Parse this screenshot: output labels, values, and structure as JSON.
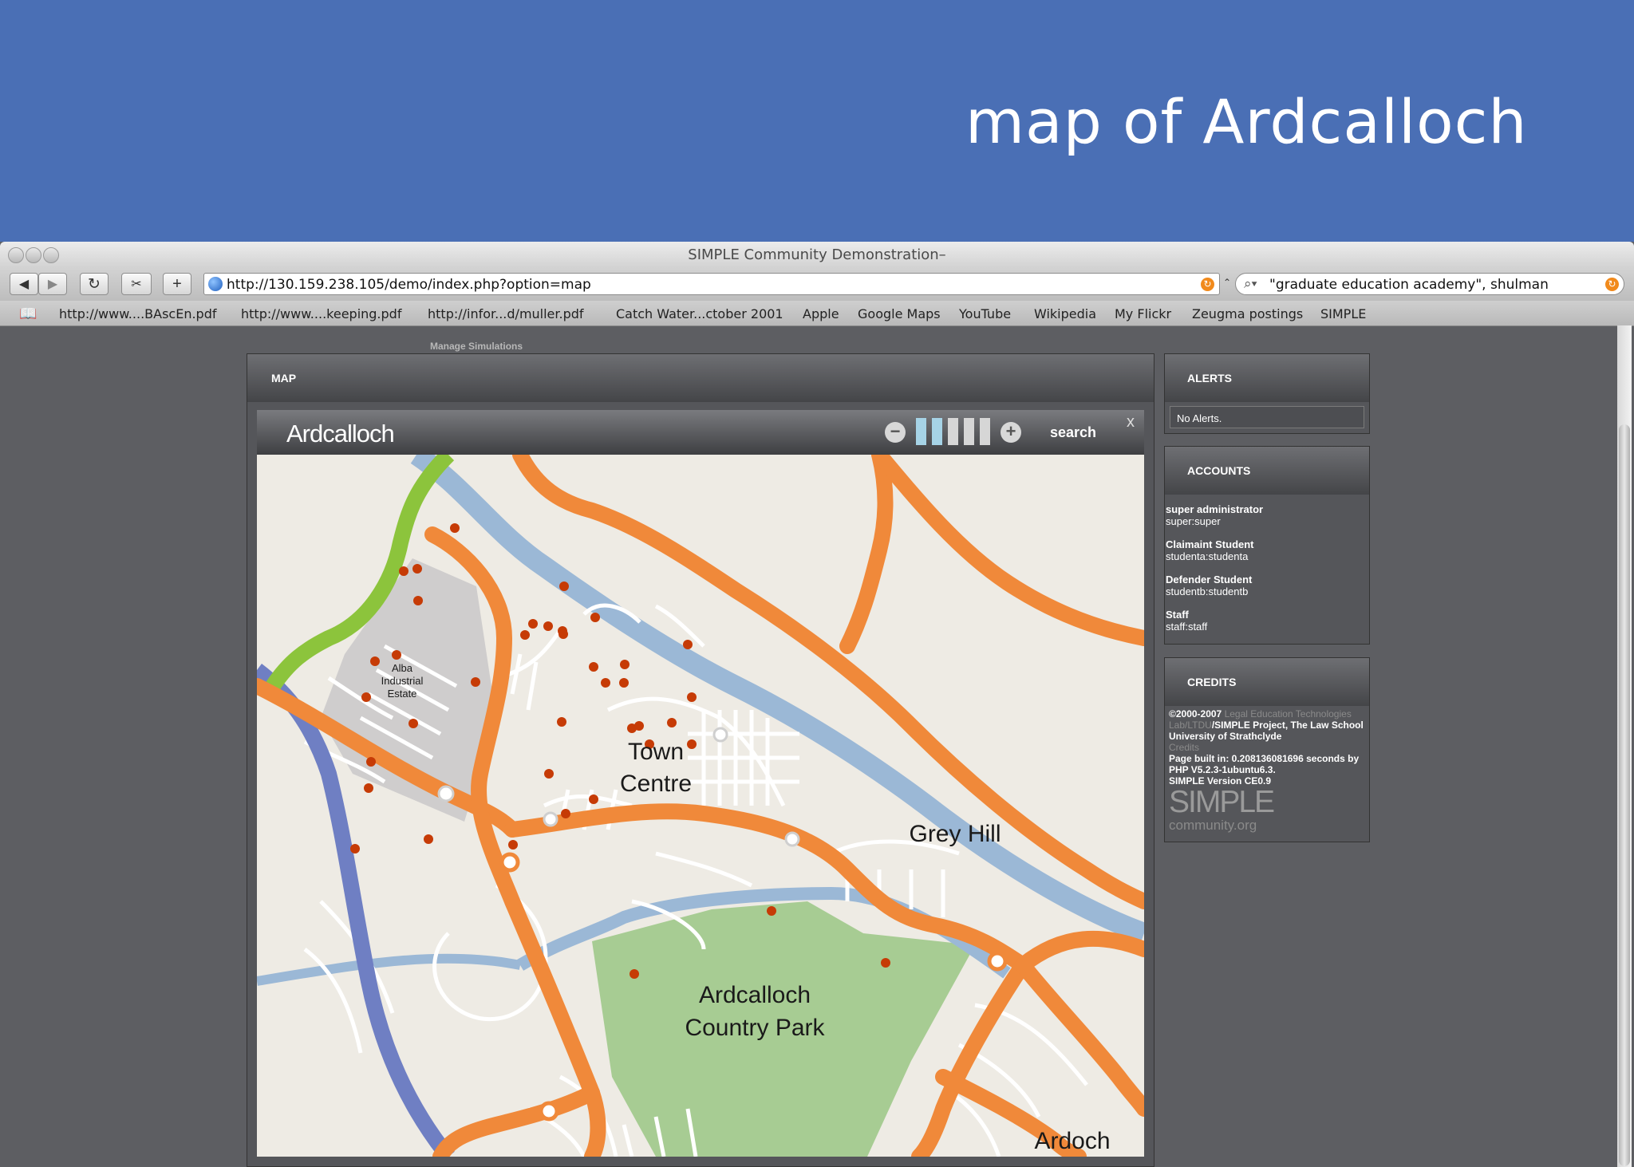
{
  "slide": {
    "title": "map of Ardcalloch"
  },
  "browser": {
    "window_title": "SIMPLE Community Demonstration–",
    "url": "http://130.159.238.105/demo/index.php?option=map",
    "search_value": "\"graduate education academy\", shulman",
    "bookmarks": [
      "http://www....BAscEn.pdf",
      "http://www....keeping.pdf",
      "http://infor...d/muller.pdf",
      "Catch Water...ctober 2001",
      "Apple",
      "Google Maps",
      "YouTube",
      "Wikipedia",
      "My Flickr",
      "Zeugma postings",
      "SIMPLE"
    ]
  },
  "page": {
    "manage_link": "Manage Simulations",
    "map_panel": {
      "header": "MAP",
      "widget_title": "Ardcalloch",
      "search_label": "search",
      "close_label": "x",
      "zoom_out": "−",
      "zoom_in": "+",
      "zoom_level": 2,
      "zoom_levels": 5,
      "place_labels": {
        "industrial": [
          "Alba",
          "Industrial",
          "Estate"
        ],
        "town_centre": [
          "Town",
          "Centre"
        ],
        "grey_hill": "Grey Hill",
        "park": [
          "Ardcalloch",
          "Country Park"
        ],
        "ardoch": "Ardoch"
      }
    },
    "alerts": {
      "header": "ALERTS",
      "message": "No Alerts."
    },
    "accounts": {
      "header": "ACCOUNTS",
      "items": [
        {
          "role": "super administrator",
          "login": "super:super"
        },
        {
          "role": "Claimaint Student",
          "login": "studenta:studenta"
        },
        {
          "role": "Defender Student",
          "login": "studentb:studentb"
        },
        {
          "role": "Staff",
          "login": "staff:staff"
        }
      ]
    },
    "credits": {
      "header": "CREDITS",
      "copyright": "©2000-2007",
      "lab_link": "Legal Education Technologies Lab/LTDU",
      "project_text": "/SIMPLE Project, The Law School University of Strathclyde",
      "credits_link": "Credits",
      "build_info": "Page built in: 0.208136081696 seconds by PHP V5.2.3-1ubuntu6.3.",
      "version": "SIMPLE Version CE0.9",
      "logo_word": "SIMPLE",
      "logo_domain": "community.org"
    }
  },
  "colors": {
    "slide_blue": "#4a6fb5",
    "road_orange": "#f0893a",
    "river_blue": "#9bb8d6",
    "park_green": "#a7cc93",
    "rail_purple": "#6f7fc3",
    "green_route": "#8cc43c",
    "marker_red": "#c63b06"
  }
}
